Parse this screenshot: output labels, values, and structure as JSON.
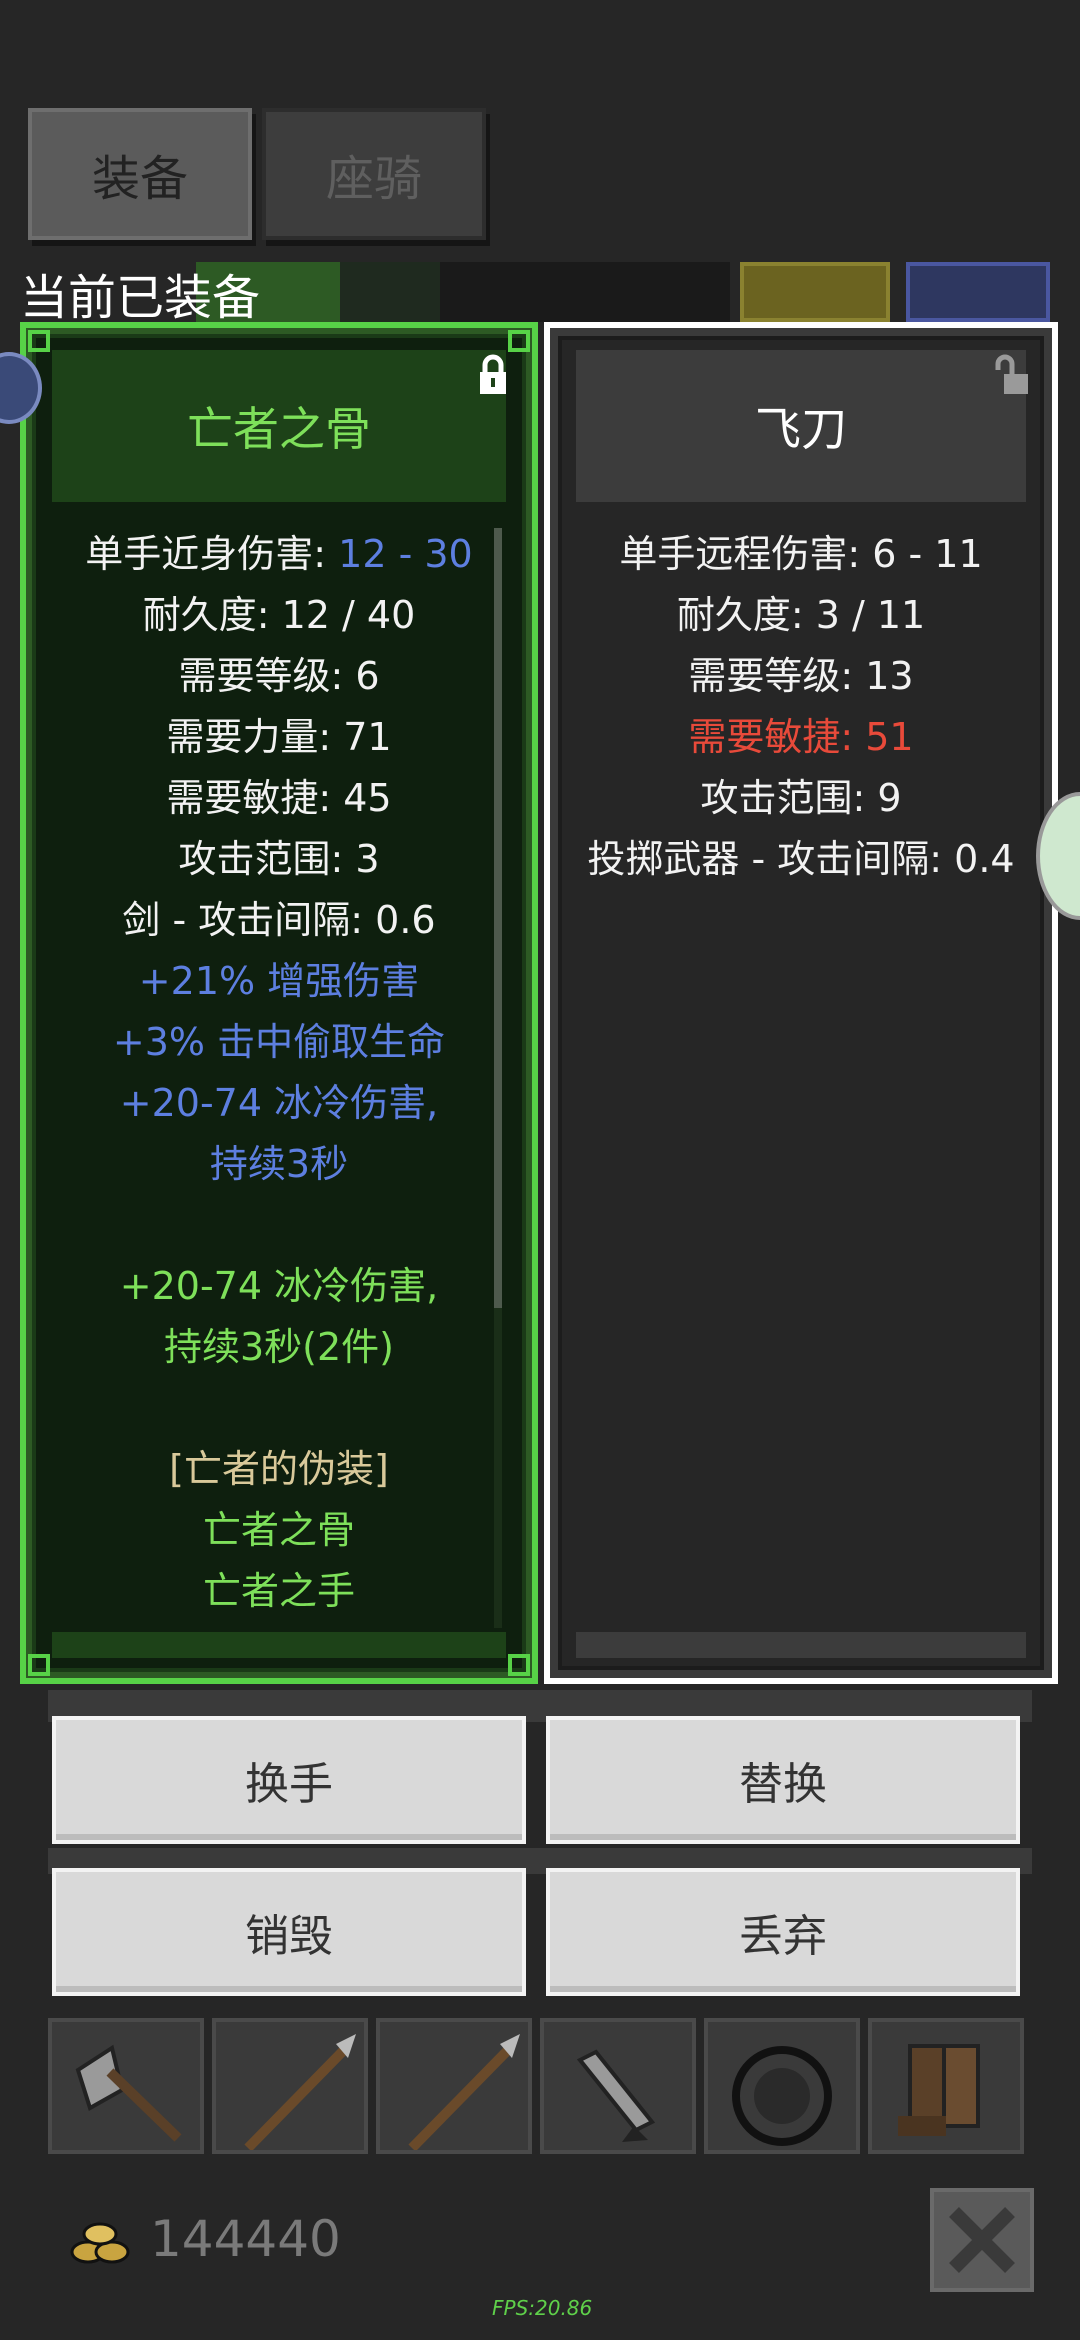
{
  "tabs": [
    {
      "label": "装备",
      "active": true
    },
    {
      "label": "座骑",
      "active": false
    }
  ],
  "equipped_label": "当前已装备",
  "left_item": {
    "name": "亡者之骨",
    "lines": [
      {
        "parts": [
          {
            "text": "单手近身伤害: ",
            "color": "white"
          },
          {
            "text": "12 - 30",
            "color": "blue"
          }
        ]
      },
      {
        "parts": [
          {
            "text": "耐久度: 12 / 40",
            "color": "white"
          }
        ]
      },
      {
        "parts": [
          {
            "text": "需要等级: 6",
            "color": "white"
          }
        ]
      },
      {
        "parts": [
          {
            "text": "需要力量: 71",
            "color": "white"
          }
        ]
      },
      {
        "parts": [
          {
            "text": "需要敏捷: 45",
            "color": "white"
          }
        ]
      },
      {
        "parts": [
          {
            "text": "攻击范围: 3",
            "color": "white"
          }
        ]
      },
      {
        "parts": [
          {
            "text": "剑 - 攻击间隔: 0.6",
            "color": "white"
          }
        ]
      },
      {
        "parts": [
          {
            "text": "+21% 增强伤害",
            "color": "blue"
          }
        ]
      },
      {
        "parts": [
          {
            "text": "+3% 击中偷取生命",
            "color": "blue"
          }
        ]
      },
      {
        "parts": [
          {
            "text": "+20-74 冰冷伤害,",
            "color": "blue"
          }
        ]
      },
      {
        "parts": [
          {
            "text": "持续3秒",
            "color": "blue"
          }
        ]
      },
      {
        "parts": [
          {
            "text": "",
            "color": "white"
          }
        ]
      },
      {
        "parts": [
          {
            "text": "+20-74 冰冷伤害,",
            "color": "lgreen"
          }
        ]
      },
      {
        "parts": [
          {
            "text": "持续3秒(2件)",
            "color": "lgreen"
          }
        ]
      },
      {
        "parts": [
          {
            "text": "",
            "color": "white"
          }
        ]
      },
      {
        "parts": [
          {
            "text": "[亡者的伪装]",
            "color": "tan"
          }
        ]
      },
      {
        "parts": [
          {
            "text": "亡者之骨",
            "color": "lgreen"
          }
        ]
      },
      {
        "parts": [
          {
            "text": "亡者之手",
            "color": "lgreen"
          }
        ]
      }
    ]
  },
  "right_item": {
    "name": "飞刀",
    "lines": [
      {
        "parts": [
          {
            "text": "单手远程伤害: 6 - 11",
            "color": "white"
          }
        ]
      },
      {
        "parts": [
          {
            "text": "耐久度: 3 / 11",
            "color": "white"
          }
        ]
      },
      {
        "parts": [
          {
            "text": "需要等级: 13",
            "color": "white"
          }
        ]
      },
      {
        "parts": [
          {
            "text": "需要敏捷: 51",
            "color": "red"
          }
        ]
      },
      {
        "parts": [
          {
            "text": "攻击范围: 9",
            "color": "white"
          }
        ]
      },
      {
        "parts": [
          {
            "text": "投掷武器 - 攻击间隔: 0.4",
            "color": "white"
          }
        ]
      }
    ]
  },
  "buttons": {
    "swap_hand": "换手",
    "replace": "替换",
    "destroy": "销毁",
    "discard": "丢弃"
  },
  "inventory_icons": [
    "axe-icon",
    "spear-icon",
    "spear-icon",
    "knife-icon",
    "shield-icon",
    "boots-icon"
  ],
  "gold": "144440",
  "fps": "FPS:20.86",
  "colors": {
    "rare_green": "#57d247",
    "magic_blue": "#5d7fe0",
    "warning_red": "#e84a3a",
    "set_tan": "#d9c99a"
  }
}
